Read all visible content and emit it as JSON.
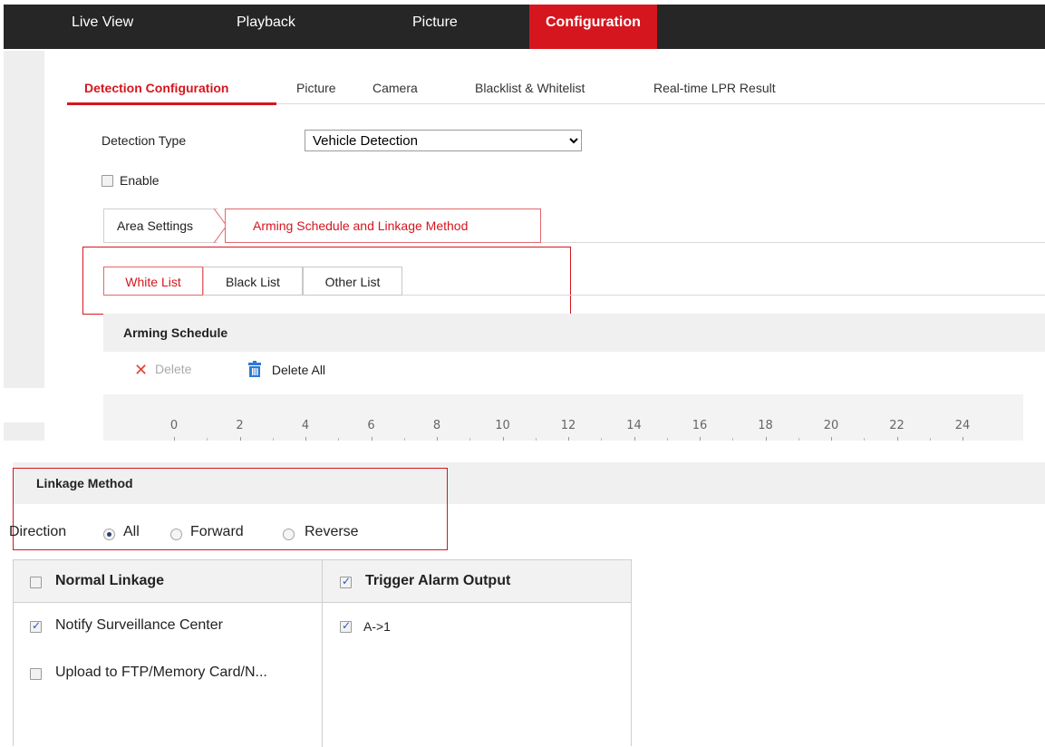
{
  "nav": {
    "live_view": "Live View",
    "playback": "Playback",
    "picture": "Picture",
    "configuration": "Configuration"
  },
  "subtabs": {
    "detection": "Detection Configuration",
    "picture": "Picture",
    "camera": "Camera",
    "blacklist": "Blacklist & Whitelist",
    "lpr": "Real-time LPR Result"
  },
  "detection": {
    "type_label": "Detection Type",
    "type_value": "Vehicle Detection",
    "enable_label": "Enable"
  },
  "steps": {
    "area": "Area Settings",
    "arming": "Arming Schedule and Linkage Method"
  },
  "lists": {
    "white": "White List",
    "black": "Black List",
    "other": "Other List"
  },
  "schedule": {
    "title": "Arming Schedule",
    "delete": "Delete",
    "delete_all": "Delete All",
    "ticks": [
      "0",
      "2",
      "4",
      "6",
      "8",
      "10",
      "12",
      "14",
      "16",
      "18",
      "20",
      "22",
      "24"
    ]
  },
  "linkage": {
    "title": "Linkage Method",
    "direction_label": "Direction",
    "dir_all": "All",
    "dir_forward": "Forward",
    "dir_reverse": "Reverse",
    "normal_header": "Normal Linkage",
    "trigger_header": "Trigger Alarm Output",
    "notify": "Notify Surveillance Center",
    "upload": "Upload to FTP/Memory Card/N...",
    "output_a1": "A->1"
  },
  "colors": {
    "accent": "#d5161e",
    "nav_bg": "#262626"
  }
}
